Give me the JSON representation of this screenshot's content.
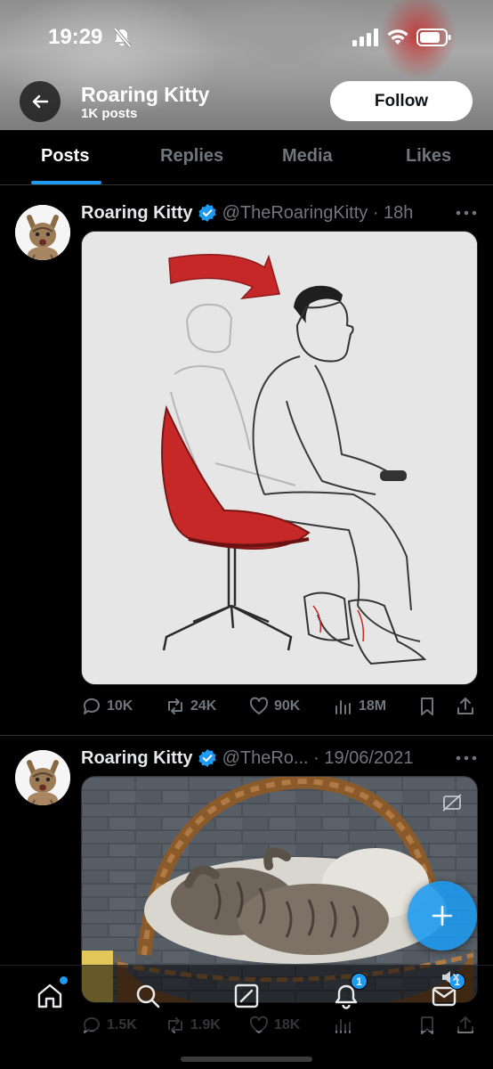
{
  "status_bar": {
    "time": "19:29"
  },
  "header": {
    "profile_name": "Roaring Kitty",
    "posts_count": "1K posts",
    "follow_label": "Follow"
  },
  "tabs": [
    {
      "label": "Posts",
      "active": true
    },
    {
      "label": "Replies",
      "active": false
    },
    {
      "label": "Media",
      "active": false
    },
    {
      "label": "Likes",
      "active": false
    }
  ],
  "tweets": [
    {
      "name": "Roaring Kitty",
      "handle": "@TheRoaringKitty",
      "time": "18h",
      "replies": "10K",
      "reposts": "24K",
      "likes": "90K",
      "views": "18M"
    },
    {
      "name": "Roaring Kitty",
      "handle": "@TheRo...",
      "time": "19/06/2021",
      "replies": "1.5K",
      "reposts": "1.9K",
      "likes": "18K",
      "views": ""
    }
  ],
  "bottom_nav": {
    "items": [
      "home-icon",
      "search-icon",
      "grok-icon",
      "notifications-icon",
      "messages-icon"
    ],
    "notifications_badge": "1",
    "messages_badge": "1"
  },
  "colors": {
    "accent": "#1d9bf0",
    "background": "#000000",
    "secondary_text": "#71767b",
    "chair_red": "#c62828"
  }
}
